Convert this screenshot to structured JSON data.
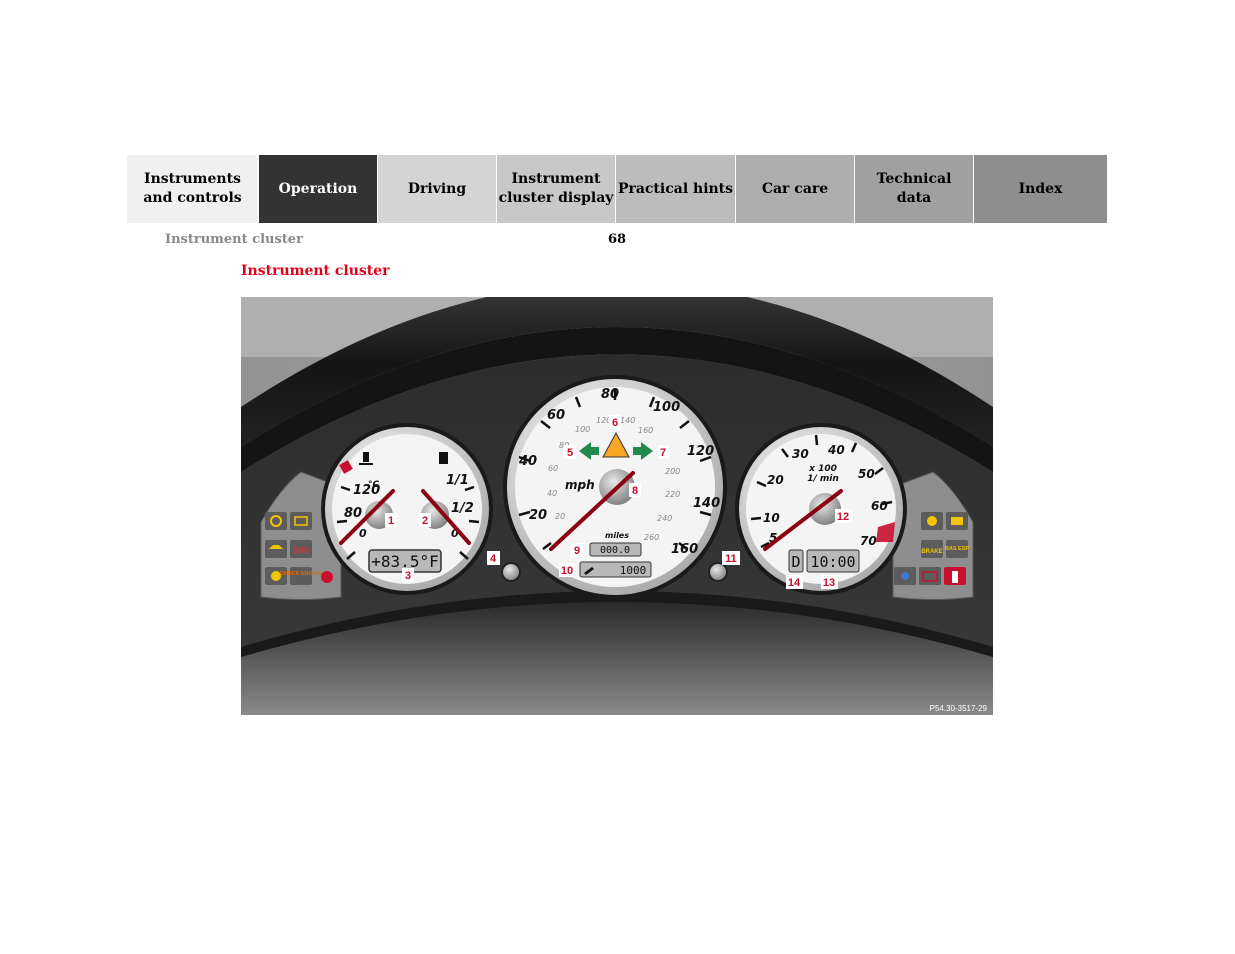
{
  "nav": {
    "tabs": [
      {
        "label": "Instruments\nand controls",
        "bg": "#f0f0f0",
        "fg": "#000000",
        "w": 132
      },
      {
        "label": "Operation",
        "bg": "#333333",
        "fg": "#ffffff",
        "w": 119
      },
      {
        "label": "Driving",
        "bg": "#d4d4d4",
        "fg": "#000000",
        "w": 119
      },
      {
        "label": "Instrument\ncluster display",
        "bg": "#c8c8c8",
        "fg": "#000000",
        "w": 119
      },
      {
        "label": "Practical hints",
        "bg": "#bcbcbc",
        "fg": "#000000",
        "w": 120
      },
      {
        "label": "Car care",
        "bg": "#aeaeae",
        "fg": "#000000",
        "w": 119
      },
      {
        "label": "Technical\ndata",
        "bg": "#a0a0a0",
        "fg": "#000000",
        "w": 119
      },
      {
        "label": "Index",
        "bg": "#8e8e8e",
        "fg": "#000000",
        "w": 134
      }
    ]
  },
  "header": {
    "section": "Instrument cluster",
    "page_number": "68"
  },
  "content": {
    "title": "Instrument cluster"
  },
  "figure": {
    "code": "P54.30-3517-29",
    "temp_scale": [
      "120",
      "80",
      "0"
    ],
    "temp_unit": "°C",
    "fuel_scale": [
      "1/1",
      "1/2",
      "0"
    ],
    "coolant_display": "+83.5°F",
    "speed_mph": [
      "20",
      "40",
      "60",
      "80",
      "100",
      "120",
      "140",
      "160"
    ],
    "speed_kmh": [
      "20",
      "40",
      "60",
      "80",
      "100",
      "120",
      "140",
      "160",
      "200",
      "220",
      "240",
      "260"
    ],
    "speed_unit": "mph",
    "odo_unit": "miles",
    "trip_display": "000.0",
    "service_display": "1000",
    "rpm_scale": [
      "5",
      "10",
      "20",
      "30",
      "40",
      "50",
      "60",
      "70"
    ],
    "rpm_unit_1": "x 100",
    "rpm_unit_2": "1/ min",
    "gear_display": "D",
    "clock_display": "10:00",
    "lamp_labels": [
      "SRS",
      "CHECK ENGINE",
      "BRAKE",
      "BAS ESP"
    ],
    "callouts": [
      "1",
      "2",
      "3",
      "4",
      "5",
      "6",
      "7",
      "8",
      "9",
      "10",
      "11",
      "12",
      "13",
      "14"
    ]
  }
}
